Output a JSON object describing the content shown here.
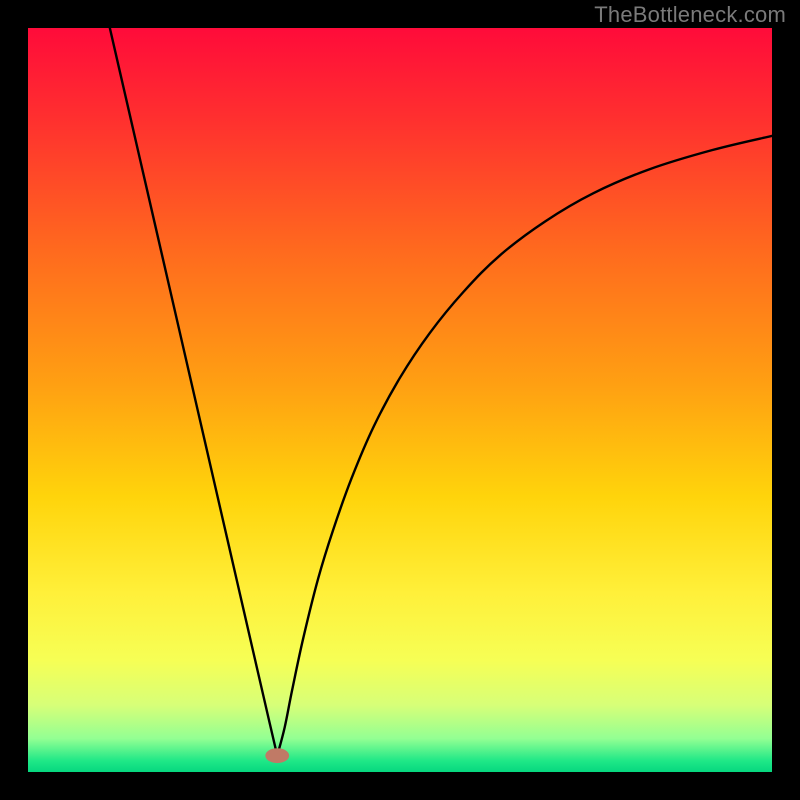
{
  "watermark": "TheBottleneck.com",
  "chart_data": {
    "type": "line",
    "title": "",
    "xlabel": "",
    "ylabel": "",
    "xlim": [
      0,
      100
    ],
    "ylim": [
      0,
      100
    ],
    "grid": false,
    "legend": false,
    "gradient_stops": [
      {
        "offset": 0.0,
        "color": "#ff0b3a"
      },
      {
        "offset": 0.12,
        "color": "#ff2f2f"
      },
      {
        "offset": 0.3,
        "color": "#ff6a1e"
      },
      {
        "offset": 0.48,
        "color": "#ffa012"
      },
      {
        "offset": 0.63,
        "color": "#ffd40b"
      },
      {
        "offset": 0.76,
        "color": "#fff03a"
      },
      {
        "offset": 0.85,
        "color": "#f6ff55"
      },
      {
        "offset": 0.91,
        "color": "#d7ff78"
      },
      {
        "offset": 0.955,
        "color": "#93ff93"
      },
      {
        "offset": 0.985,
        "color": "#1fe887"
      },
      {
        "offset": 1.0,
        "color": "#06d77f"
      }
    ],
    "marker": {
      "x": 33.5,
      "y": 2.2,
      "rx": 1.6,
      "ry": 1.0,
      "color": "#c07a66"
    },
    "series": [
      {
        "name": "curve-left",
        "color": "#000000",
        "x": [
          11.0,
          13.0,
          15.0,
          17.0,
          19.0,
          21.0,
          23.0,
          25.0,
          27.0,
          29.0,
          31.0,
          32.5,
          33.5
        ],
        "y": [
          100.0,
          91.3,
          82.6,
          73.9,
          65.2,
          56.5,
          47.8,
          39.1,
          30.4,
          21.7,
          13.0,
          6.5,
          2.2
        ]
      },
      {
        "name": "curve-right",
        "color": "#000000",
        "x": [
          33.5,
          34.5,
          35.5,
          37.0,
          39.0,
          41.0,
          43.5,
          46.5,
          50.0,
          54.0,
          58.5,
          63.5,
          69.5,
          76.0,
          83.5,
          92.0,
          100.0
        ],
        "y": [
          2.2,
          6.0,
          11.0,
          18.0,
          26.0,
          32.5,
          39.5,
          46.5,
          53.0,
          59.0,
          64.5,
          69.5,
          74.0,
          77.8,
          81.0,
          83.6,
          85.5
        ]
      }
    ]
  }
}
